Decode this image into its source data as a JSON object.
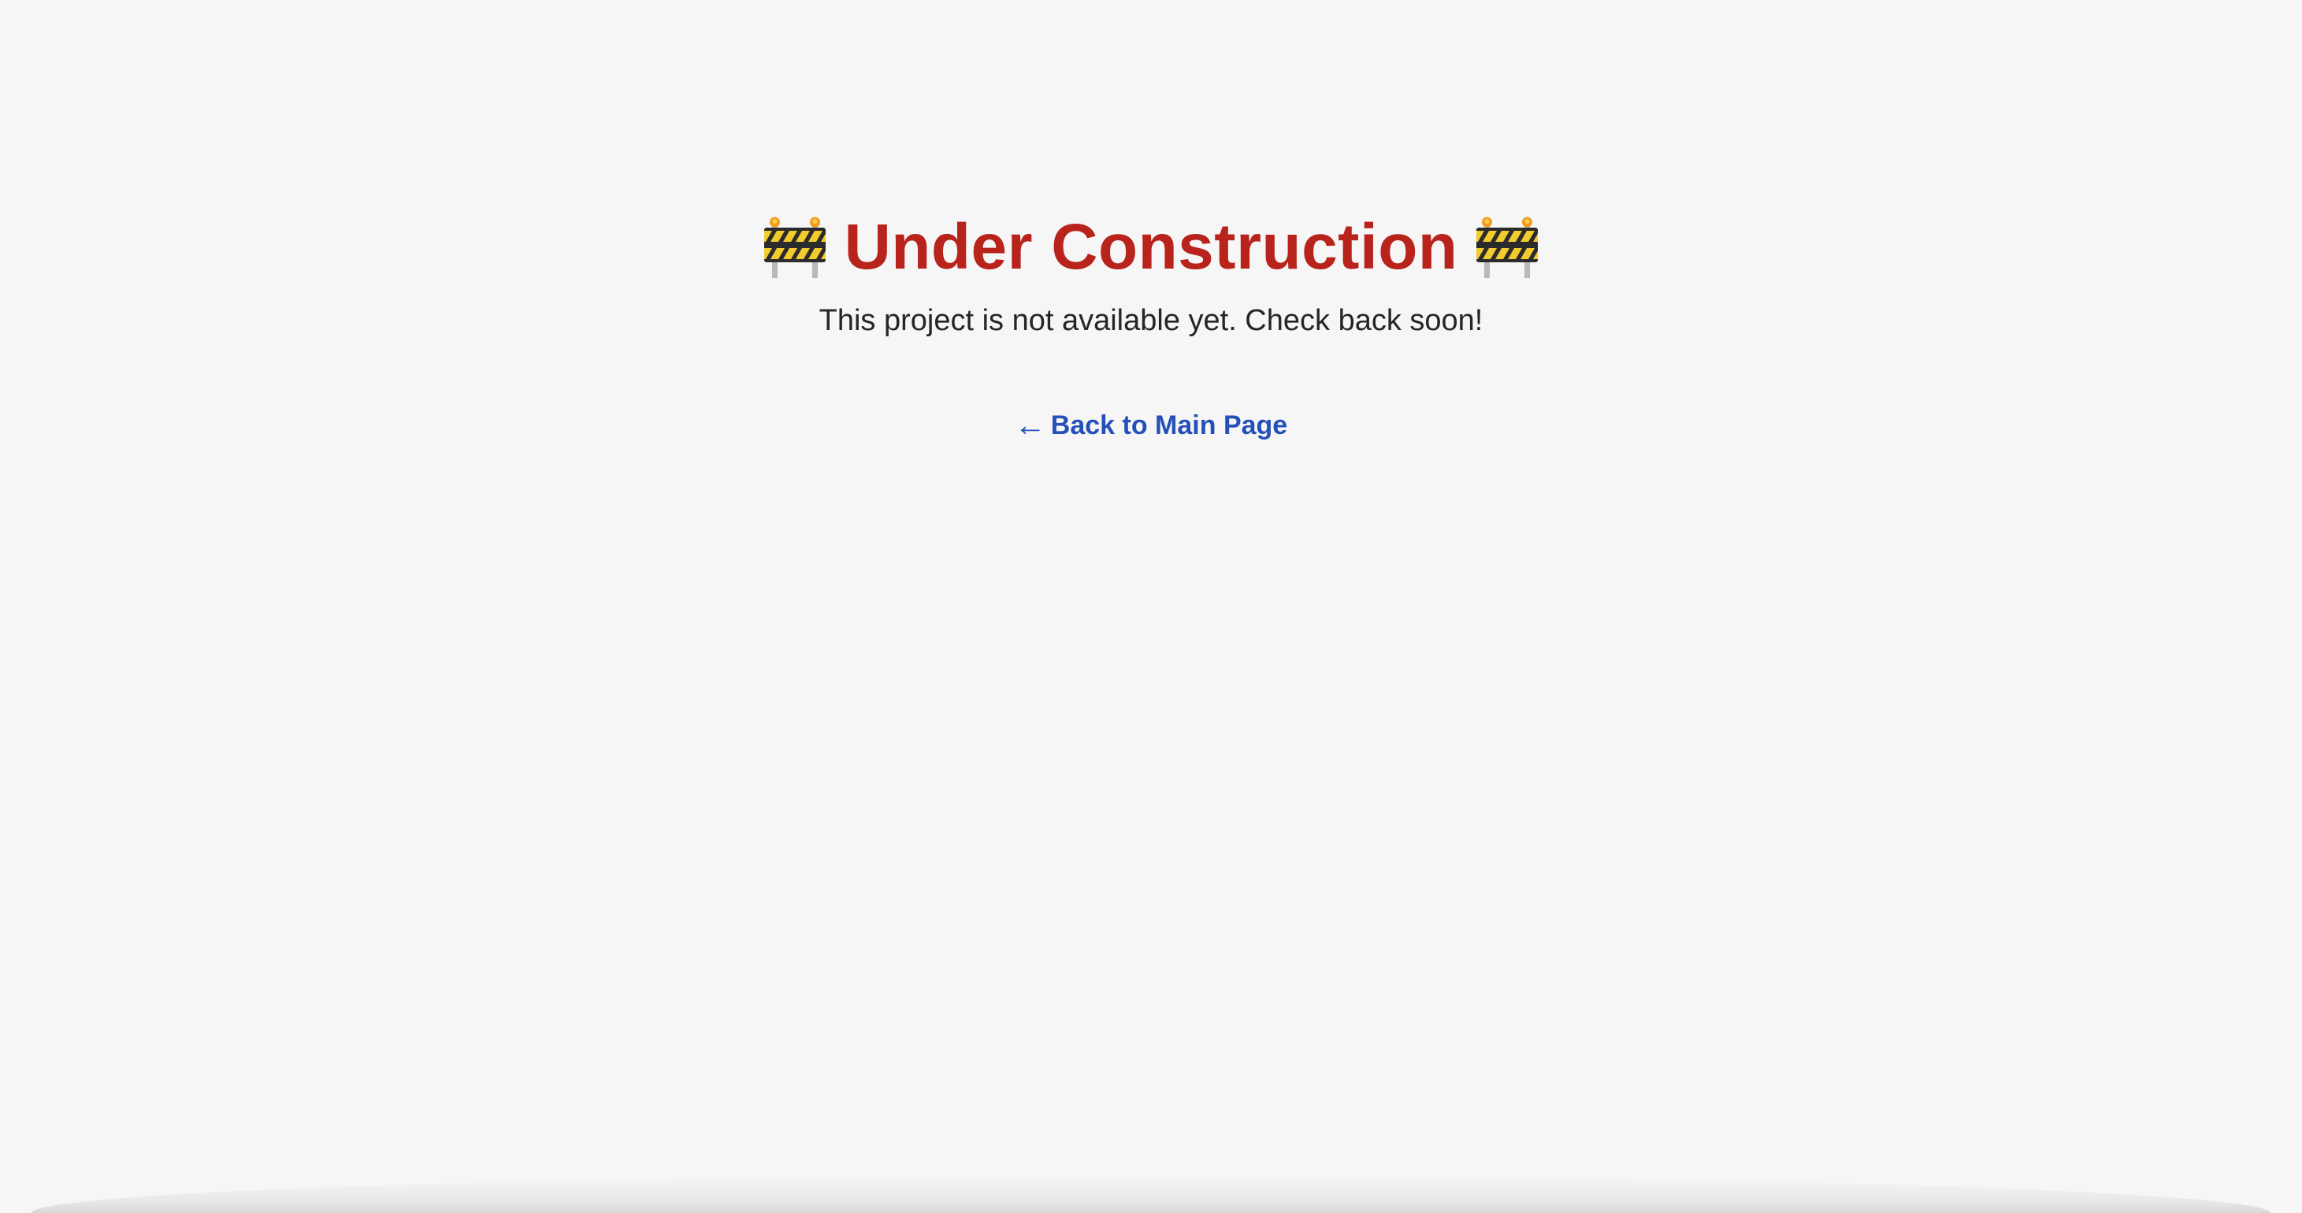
{
  "heading": {
    "text": "Under Construction",
    "left_icon": "construction-barrier-icon",
    "right_icon": "construction-barrier-icon"
  },
  "subtitle": "This project is not available yet. Check back soon!",
  "back_link": {
    "arrow": "←",
    "label": "Back to Main Page"
  },
  "colors": {
    "background": "#f6f6f6",
    "heading": "#b8231c",
    "body_text": "#262626",
    "link": "#2450b8",
    "barrier_yellow": "#f2cc2e",
    "barrier_black": "#2b2b2b",
    "barrier_post": "#b9b9b9",
    "barrier_light": "#f59a1b"
  }
}
